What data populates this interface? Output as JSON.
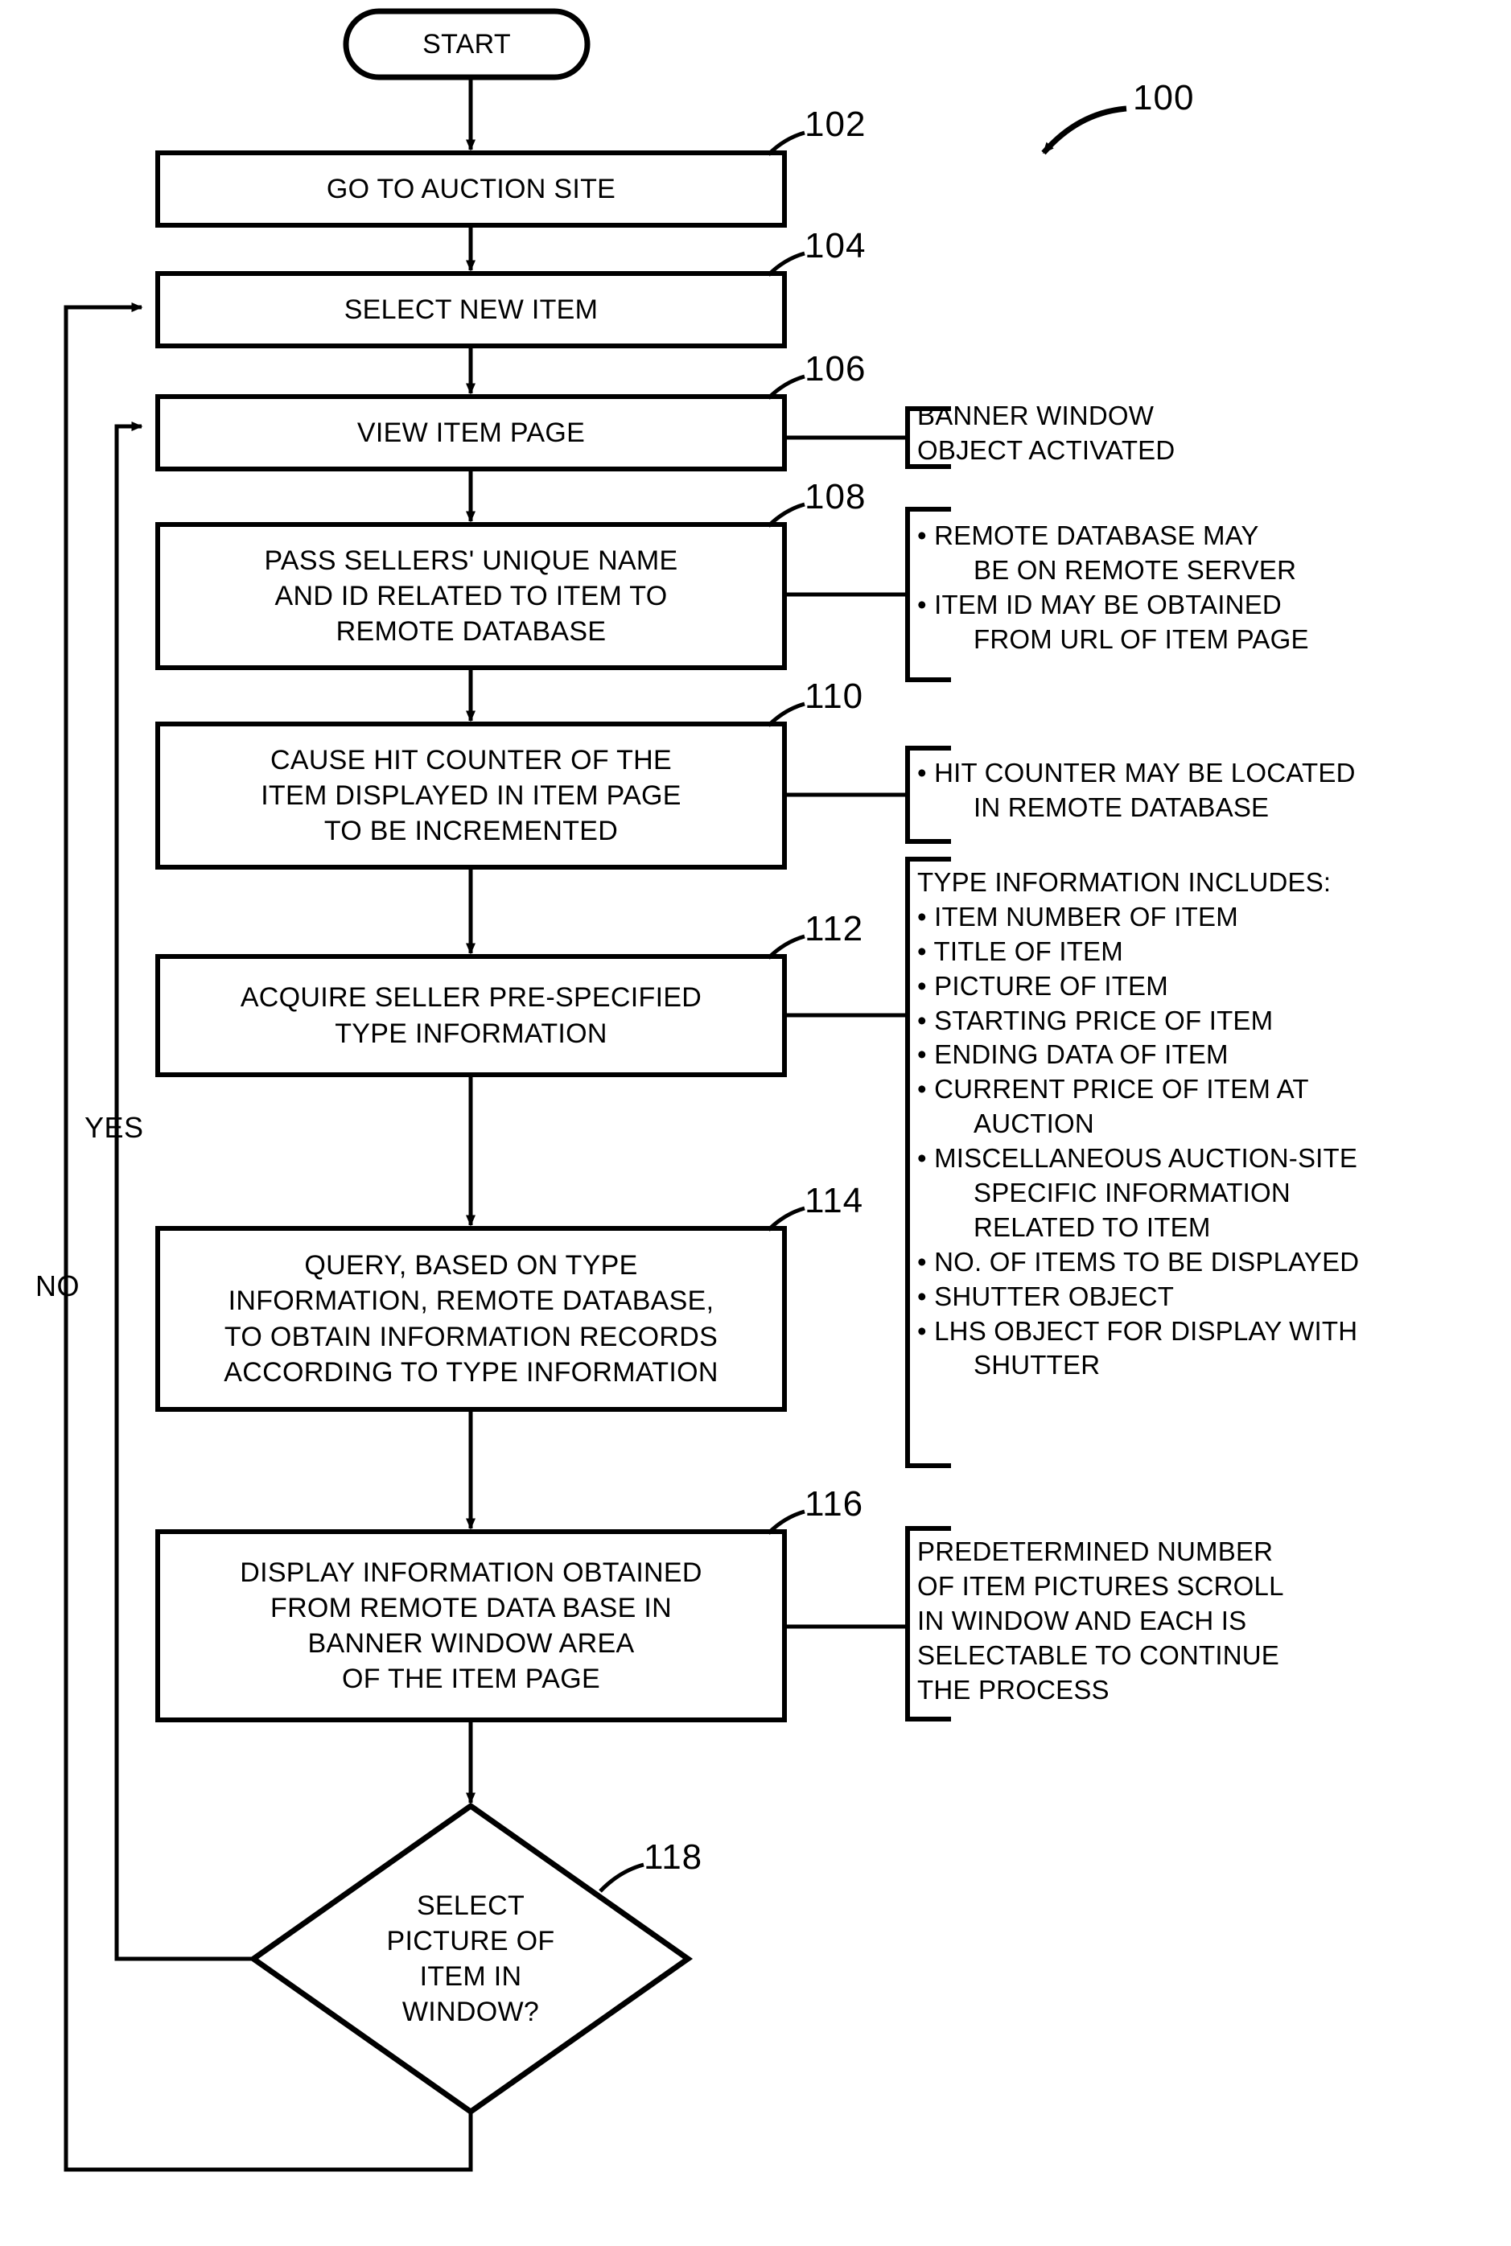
{
  "figure": {
    "reference_label": "100"
  },
  "nodes": [
    {
      "id": "start",
      "type": "terminator",
      "lines": [
        "START"
      ],
      "ref": ""
    },
    {
      "id": "n102",
      "type": "process",
      "lines": [
        "GO TO AUCTION SITE"
      ],
      "ref": "102"
    },
    {
      "id": "n104",
      "type": "process",
      "lines": [
        "SELECT NEW ITEM"
      ],
      "ref": "104"
    },
    {
      "id": "n106",
      "type": "process",
      "lines": [
        "VIEW ITEM PAGE"
      ],
      "ref": "106"
    },
    {
      "id": "n108",
      "type": "process",
      "lines": [
        "PASS SELLERS' UNIQUE NAME",
        "AND ID RELATED TO ITEM TO",
        "REMOTE DATABASE"
      ],
      "ref": "108"
    },
    {
      "id": "n110",
      "type": "process",
      "lines": [
        "CAUSE HIT COUNTER OF THE",
        "ITEM DISPLAYED IN ITEM PAGE",
        "TO BE INCREMENTED"
      ],
      "ref": "110"
    },
    {
      "id": "n112",
      "type": "process",
      "lines": [
        "ACQUIRE SELLER PRE-SPECIFIED",
        "TYPE INFORMATION"
      ],
      "ref": "112"
    },
    {
      "id": "n114",
      "type": "process",
      "lines": [
        "QUERY, BASED ON TYPE",
        "INFORMATION, REMOTE DATABASE,",
        "TO OBTAIN INFORMATION RECORDS",
        "ACCORDING TO TYPE INFORMATION"
      ],
      "ref": "114"
    },
    {
      "id": "n116",
      "type": "process",
      "lines": [
        "DISPLAY INFORMATION OBTAINED",
        "FROM REMOTE DATA BASE IN",
        "BANNER WINDOW AREA",
        "OF THE ITEM PAGE"
      ],
      "ref": "116"
    },
    {
      "id": "n118",
      "type": "decision",
      "lines": [
        "SELECT",
        "PICTURE OF",
        "ITEM IN",
        "WINDOW?"
      ],
      "ref": "118"
    }
  ],
  "annotations": [
    {
      "id": "a106",
      "for": "106",
      "lines": [
        {
          "style": "plain",
          "text": "BANNER WINDOW"
        },
        {
          "style": "plain",
          "text": "OBJECT ACTIVATED"
        }
      ]
    },
    {
      "id": "a108",
      "for": "108",
      "lines": [
        {
          "style": "bullet",
          "text": "• REMOTE DATABASE MAY"
        },
        {
          "style": "cont",
          "text": "BE ON REMOTE SERVER"
        },
        {
          "style": "bullet",
          "text": "• ITEM ID MAY BE OBTAINED"
        },
        {
          "style": "cont",
          "text": "FROM URL OF ITEM PAGE"
        }
      ]
    },
    {
      "id": "a110",
      "for": "110",
      "lines": [
        {
          "style": "bullet",
          "text": "• HIT COUNTER MAY BE LOCATED"
        },
        {
          "style": "cont",
          "text": "IN REMOTE DATABASE"
        }
      ]
    },
    {
      "id": "a112",
      "for": "112",
      "lines": [
        {
          "style": "plain",
          "text": "TYPE INFORMATION INCLUDES:"
        },
        {
          "style": "bullet",
          "text": "• ITEM NUMBER OF ITEM"
        },
        {
          "style": "bullet",
          "text": "• TITLE OF ITEM"
        },
        {
          "style": "bullet",
          "text": "• PICTURE OF ITEM"
        },
        {
          "style": "bullet",
          "text": "• STARTING PRICE OF ITEM"
        },
        {
          "style": "bullet",
          "text": "• ENDING DATA OF ITEM"
        },
        {
          "style": "bullet",
          "text": "• CURRENT PRICE OF ITEM AT"
        },
        {
          "style": "cont",
          "text": "AUCTION"
        },
        {
          "style": "bullet",
          "text": "• MISCELLANEOUS AUCTION-SITE"
        },
        {
          "style": "cont",
          "text": "SPECIFIC INFORMATION"
        },
        {
          "style": "cont",
          "text": "RELATED TO ITEM"
        },
        {
          "style": "bullet",
          "text": "• NO. OF ITEMS TO BE DISPLAYED"
        },
        {
          "style": "bullet",
          "text": "• SHUTTER OBJECT"
        },
        {
          "style": "bullet",
          "text": "• LHS OBJECT FOR DISPLAY WITH"
        },
        {
          "style": "cont",
          "text": "SHUTTER"
        }
      ]
    },
    {
      "id": "a116",
      "for": "116",
      "lines": [
        {
          "style": "plain",
          "text": "PREDETERMINED NUMBER"
        },
        {
          "style": "plain",
          "text": "OF ITEM PICTURES SCROLL"
        },
        {
          "style": "plain",
          "text": "IN WINDOW AND EACH IS"
        },
        {
          "style": "plain",
          "text": "SELECTABLE TO CONTINUE"
        },
        {
          "style": "plain",
          "text": "THE PROCESS"
        }
      ]
    }
  ],
  "edge_labels": {
    "yes": "YES",
    "no": "NO"
  },
  "colors": {
    "stroke": "#000000",
    "background": "#ffffff"
  }
}
